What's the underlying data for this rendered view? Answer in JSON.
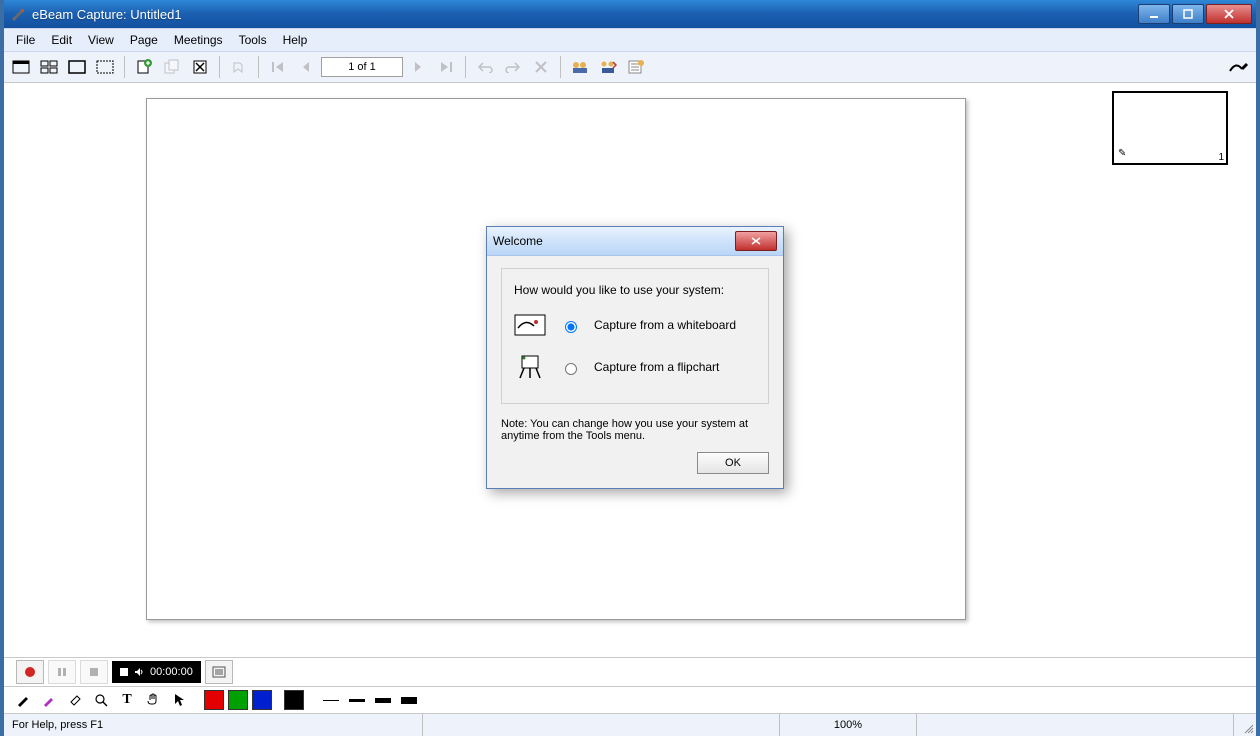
{
  "titlebar": {
    "title": "eBeam Capture: Untitled1"
  },
  "menu": {
    "items": [
      "File",
      "Edit",
      "View",
      "Page",
      "Meetings",
      "Tools",
      "Help"
    ]
  },
  "toolbar": {
    "page_indicator": "1 of 1"
  },
  "thumbnail": {
    "page_number": "1"
  },
  "media": {
    "time": "00:00:00"
  },
  "dialog": {
    "title": "Welcome",
    "prompt": "How would you like to use your system:",
    "option1": "Capture from a whiteboard",
    "option2": "Capture from a flipchart",
    "note": "Note: You can change how you use your system at anytime from the Tools menu.",
    "ok": "OK"
  },
  "status": {
    "help": "For Help, press F1",
    "zoom": "100%"
  }
}
